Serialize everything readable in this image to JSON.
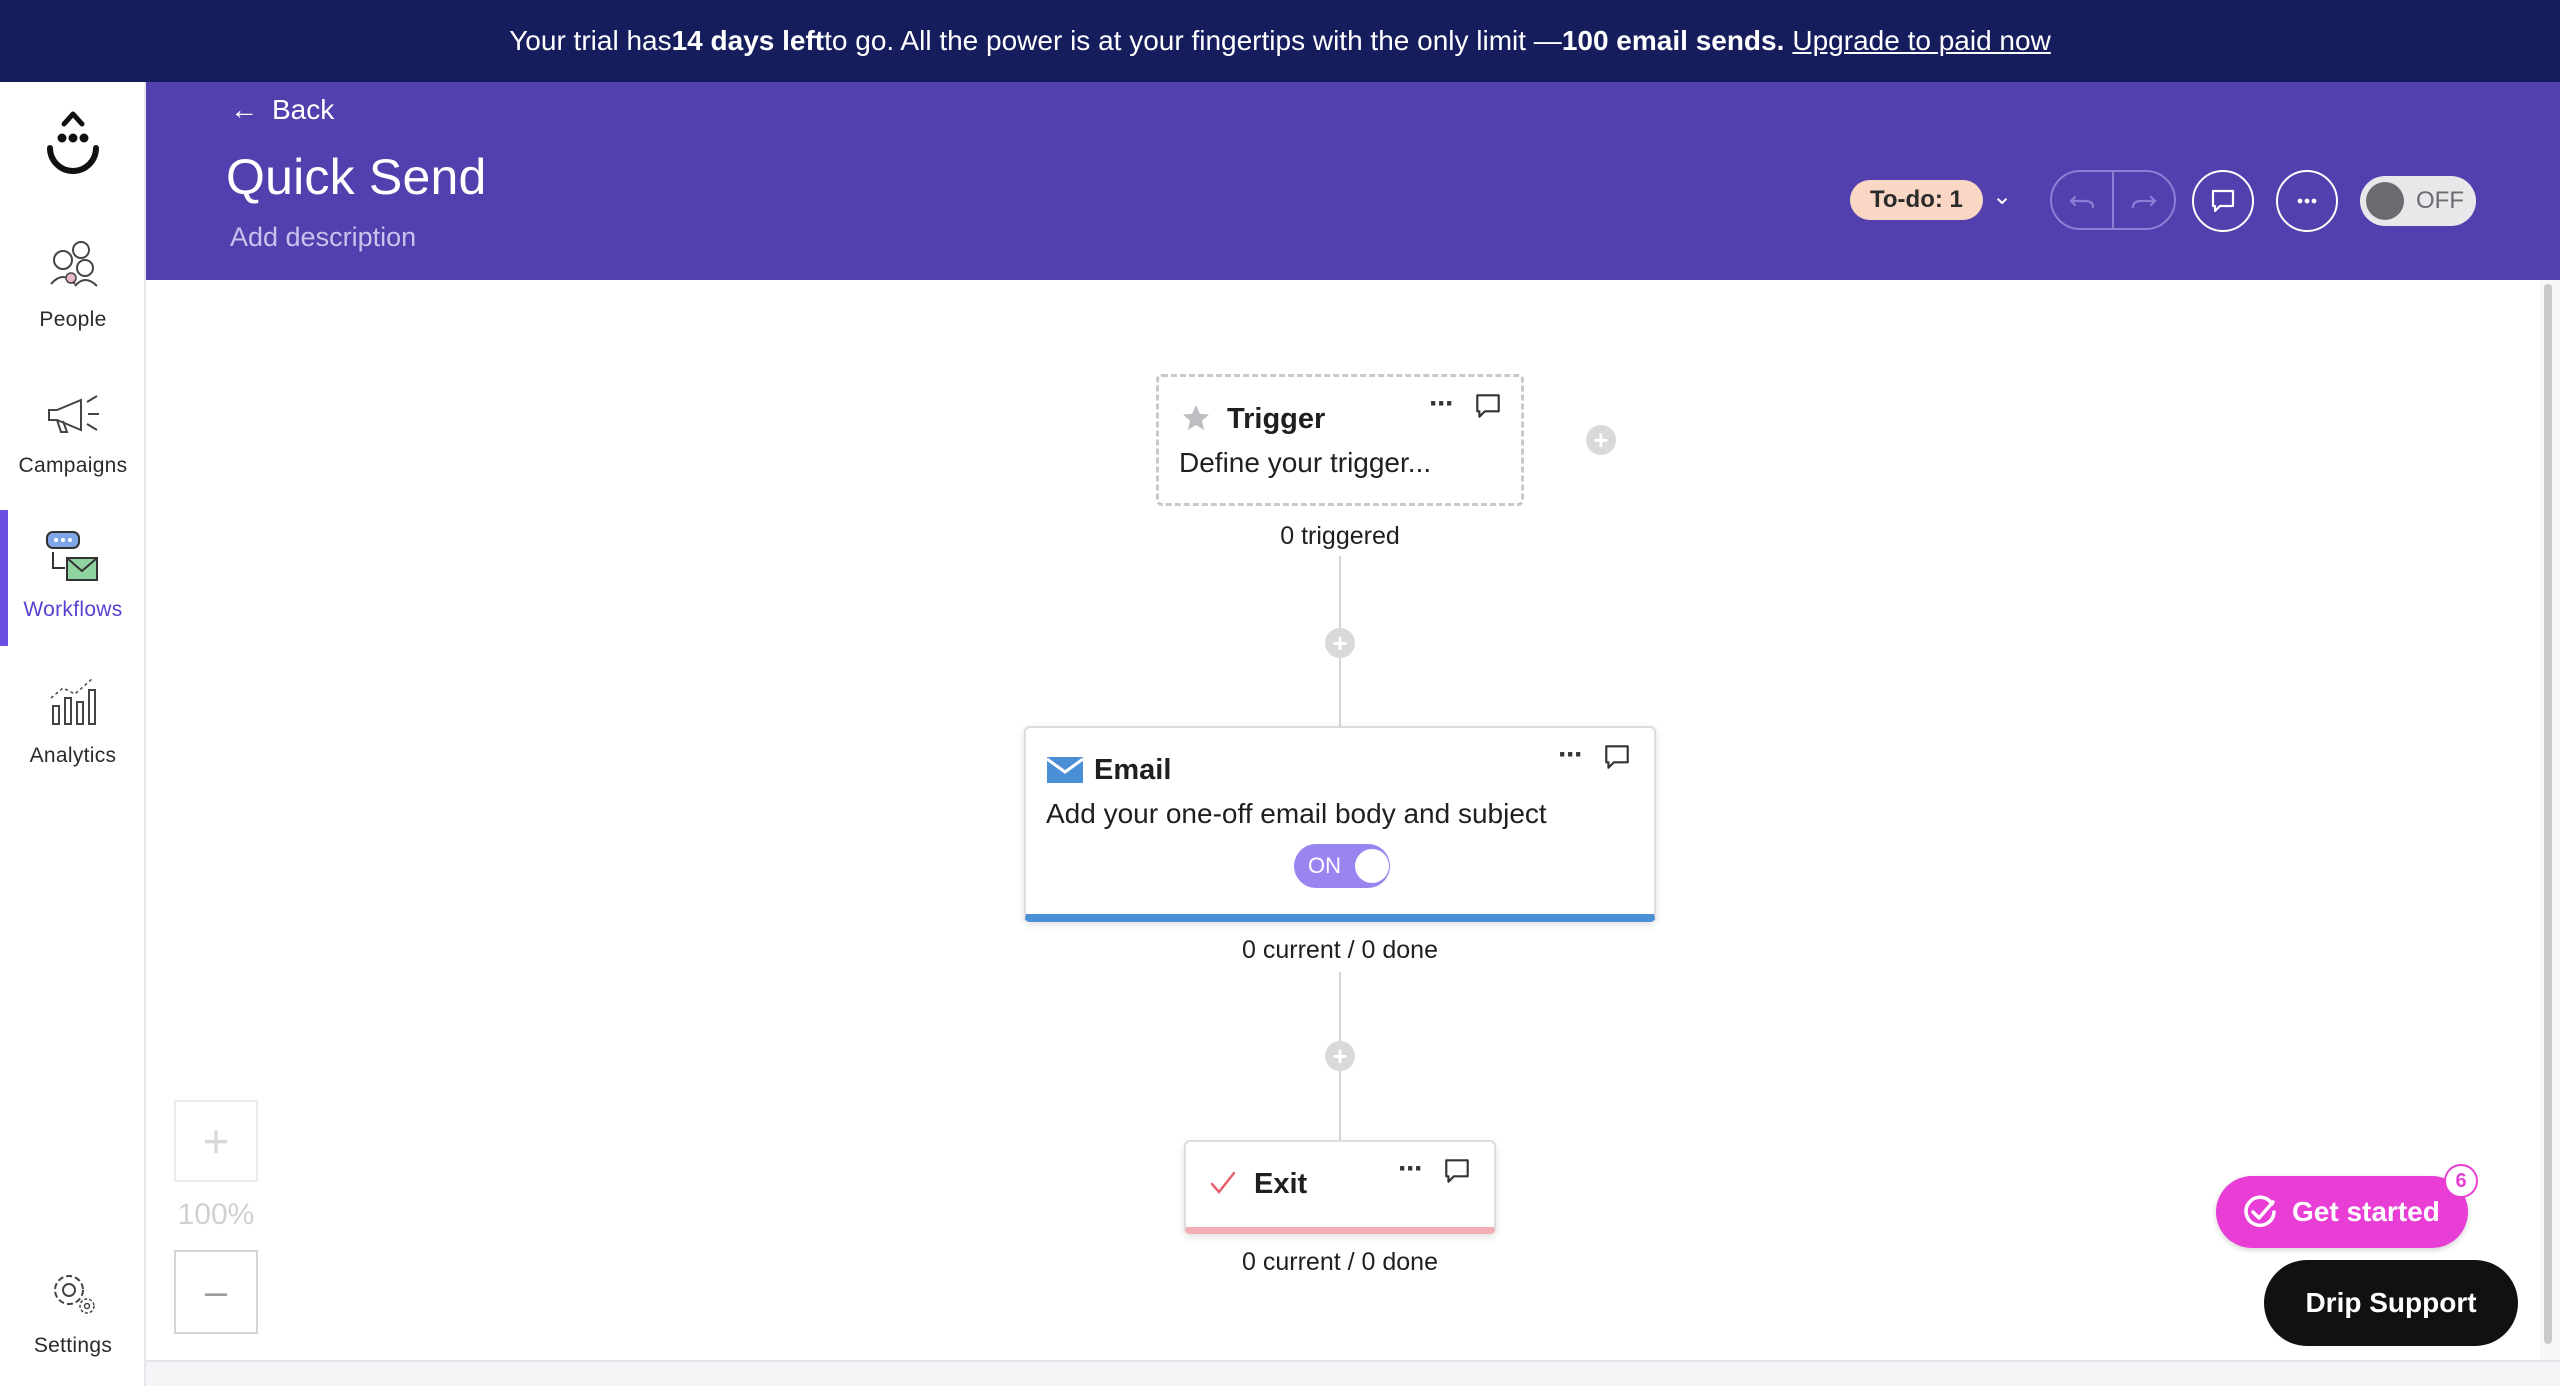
{
  "banner": {
    "text_1": "Your trial has ",
    "days_left": "14 days left",
    "text_2": " to go. All the power is at your fingertips with the only limit — ",
    "limit": "100 email sends.",
    "upgrade_link": "Upgrade to paid now"
  },
  "sidebar": {
    "logo_icon": "drip-smiley-logo",
    "items": [
      {
        "label": "People",
        "icon": "people-icon",
        "active": false
      },
      {
        "label": "Campaigns",
        "icon": "megaphone-icon",
        "active": false
      },
      {
        "label": "Workflows",
        "icon": "workflows-icon",
        "active": true
      },
      {
        "label": "Analytics",
        "icon": "analytics-icon",
        "active": false
      }
    ],
    "settings": {
      "label": "Settings",
      "icon": "gear-icon"
    }
  },
  "header": {
    "back_label": "Back",
    "title": "Quick Send",
    "description_placeholder": "Add description",
    "todo_label": "To-do: 1",
    "status_toggle_label": "OFF",
    "accent_color": "#5140ae"
  },
  "workflow": {
    "trigger": {
      "title": "Trigger",
      "subtitle": "Define your trigger...",
      "stat": "0 triggered"
    },
    "email": {
      "title": "Email",
      "subtitle": "Add your one-off email body and subject",
      "toggle_label": "ON",
      "stat": "0 current / 0 done"
    },
    "exit": {
      "title": "Exit",
      "stat": "0 current / 0 done"
    }
  },
  "zoom": {
    "in_label": "+",
    "level": "100%",
    "out_label": "–"
  },
  "floating": {
    "get_started_label": "Get started",
    "get_started_badge": "6",
    "support_label": "Drip Support"
  }
}
